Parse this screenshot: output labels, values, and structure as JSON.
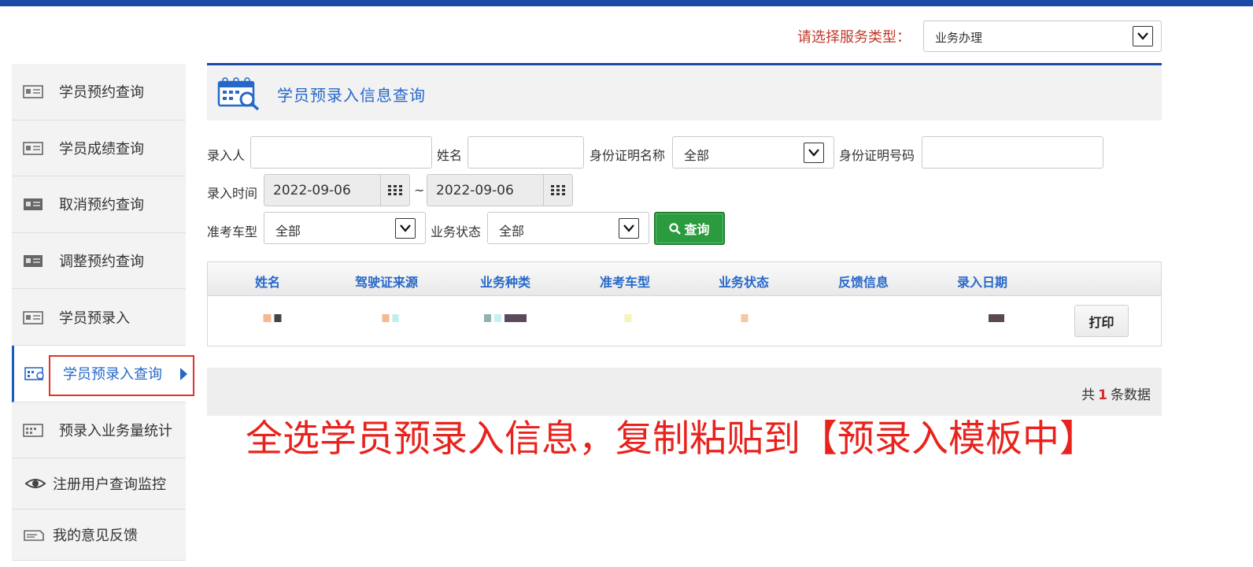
{
  "service": {
    "label": "请选择服务类型：",
    "value": "业务办理"
  },
  "sidebar": {
    "items": [
      {
        "label": "学员预约查询",
        "icon": "id-card-icon"
      },
      {
        "label": "学员成绩查询",
        "icon": "id-card-icon"
      },
      {
        "label": "取消预约查询",
        "icon": "id-card-icon"
      },
      {
        "label": "调整预约查询",
        "icon": "id-card-icon"
      },
      {
        "label": "学员预录入",
        "icon": "id-card-icon"
      },
      {
        "label": "学员预录入查询",
        "icon": "calendar-search-icon",
        "active": true
      },
      {
        "label": "预录入业务量统计",
        "icon": "calendar-icon"
      },
      {
        "label": "注册用户查询监控",
        "icon": "eye-icon"
      },
      {
        "label": "我的意见反馈",
        "icon": "feedback-icon"
      }
    ]
  },
  "panel": {
    "title": "学员预录入信息查询",
    "icon": "calendar-search-icon"
  },
  "form": {
    "recorder_label": "录入人",
    "name_label": "姓名",
    "id_type_label": "身份证明名称",
    "id_type_value": "全部",
    "id_number_label": "身份证明号码",
    "time_label": "录入时间",
    "date_from": "2022-09-06",
    "date_sep": "~",
    "date_to": "2022-09-06",
    "vehicle_label": "准考车型",
    "vehicle_value": "全部",
    "status_label": "业务状态",
    "status_value": "全部",
    "query_button": "查询"
  },
  "table": {
    "headers": [
      "姓名",
      "驾驶证来源",
      "业务种类",
      "准考车型",
      "业务状态",
      "反馈信息",
      "录入日期"
    ],
    "print_button": "打印"
  },
  "pager": {
    "prefix": "共",
    "count": "1",
    "suffix": "条数据"
  },
  "annotation": "全选学员预录入信息，复制粘贴到【预录入模板中】",
  "colors": {
    "brand": "#1a4aa5",
    "link": "#2668c9",
    "query_green": "#2a9b3e",
    "annotation_red": "#e8231d"
  }
}
